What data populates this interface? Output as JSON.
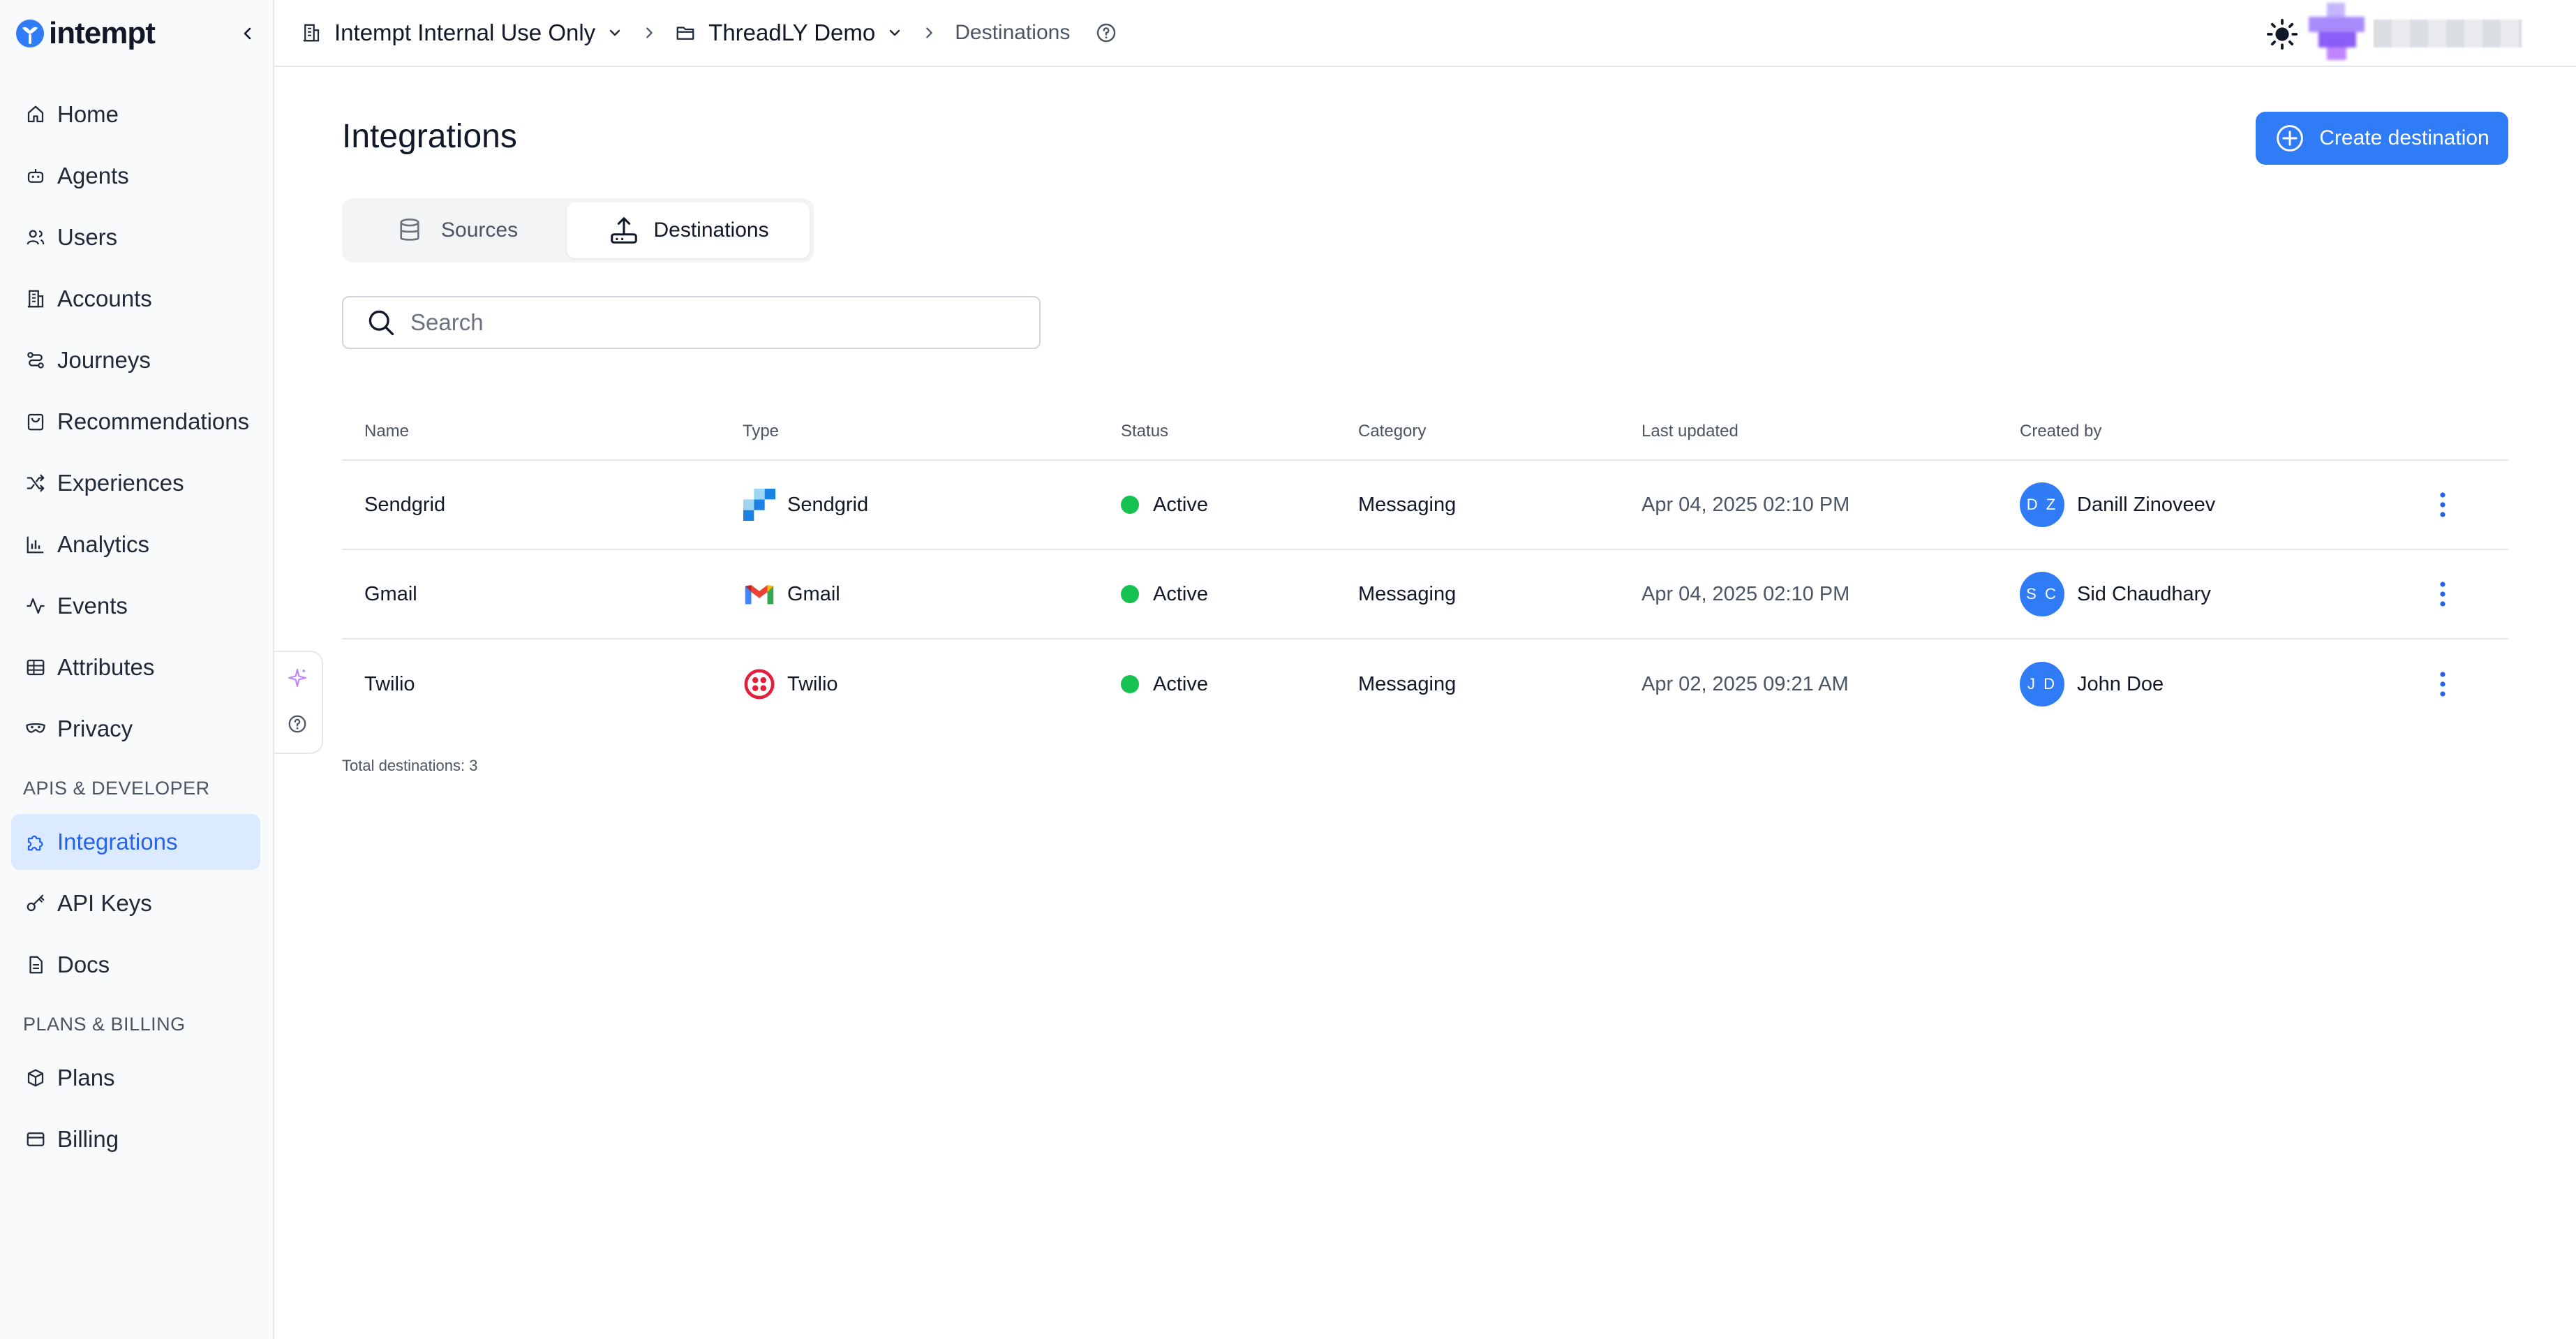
{
  "app": {
    "logo_text": "intempt",
    "brand_color": "#2f7cf6",
    "active_color": "#2563eb"
  },
  "sidebar": {
    "items": [
      {
        "label": "Home",
        "icon": "home-icon"
      },
      {
        "label": "Agents",
        "icon": "robot-icon"
      },
      {
        "label": "Users",
        "icon": "users-icon"
      },
      {
        "label": "Accounts",
        "icon": "building-icon"
      },
      {
        "label": "Journeys",
        "icon": "journey-icon"
      },
      {
        "label": "Recommendations",
        "icon": "shopping-bag-icon"
      },
      {
        "label": "Experiences",
        "icon": "shuffle-icon"
      },
      {
        "label": "Analytics",
        "icon": "bar-chart-icon"
      },
      {
        "label": "Events",
        "icon": "activity-icon"
      },
      {
        "label": "Attributes",
        "icon": "table-icon"
      },
      {
        "label": "Privacy",
        "icon": "mask-icon"
      }
    ],
    "section_dev": "APIS & DEVELOPER",
    "dev_items": [
      {
        "label": "Integrations",
        "icon": "puzzle-icon",
        "active": true
      },
      {
        "label": "API Keys",
        "icon": "key-icon"
      },
      {
        "label": "Docs",
        "icon": "document-icon"
      }
    ],
    "section_billing": "PLANS & BILLING",
    "billing_items": [
      {
        "label": "Plans",
        "icon": "box-icon"
      },
      {
        "label": "Billing",
        "icon": "credit-card-icon"
      }
    ]
  },
  "topbar": {
    "org": "Intempt Internal Use Only",
    "project": "ThreadLY Demo",
    "current": "Destinations"
  },
  "main": {
    "title": "Integrations",
    "create_button": "Create destination",
    "tabs": {
      "sources": "Sources",
      "destinations": "Destinations"
    },
    "search_placeholder": "Search",
    "columns": {
      "name": "Name",
      "type": "Type",
      "status": "Status",
      "category": "Category",
      "updated": "Last updated",
      "created_by": "Created by"
    },
    "rows": [
      {
        "name": "Sendgrid",
        "type": "Sendgrid",
        "type_icon": "sendgrid-icon",
        "status": "Active",
        "status_color": "#16c251",
        "category": "Messaging",
        "updated": "Apr 04, 2025 02:10 PM",
        "initials": "D Z",
        "creator": "Danill Zinoveev"
      },
      {
        "name": "Gmail",
        "type": "Gmail",
        "type_icon": "gmail-icon",
        "status": "Active",
        "status_color": "#16c251",
        "category": "Messaging",
        "updated": "Apr 04, 2025 02:10 PM",
        "initials": "S C",
        "creator": "Sid Chaudhary"
      },
      {
        "name": "Twilio",
        "type": "Twilio",
        "type_icon": "twilio-icon",
        "status": "Active",
        "status_color": "#16c251",
        "category": "Messaging",
        "updated": "Apr 02, 2025 09:21 AM",
        "initials": "J D",
        "creator": "John Doe"
      }
    ],
    "total": "Total destinations: 3"
  }
}
